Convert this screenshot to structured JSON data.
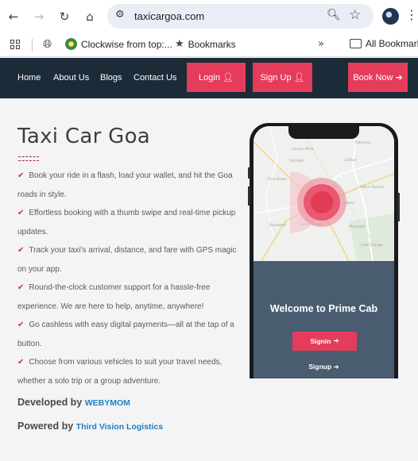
{
  "browser": {
    "url": "taxicargoa.com",
    "bookmarks": [
      {
        "label": "Clockwise from top:...",
        "icon": "wikipedia-icon"
      },
      {
        "label": "Bookmarks",
        "icon": "star-icon"
      },
      {
        "label": "All Bookmarks",
        "icon": "folder-icon"
      }
    ]
  },
  "header": {
    "nav": [
      "Home",
      "About Us",
      "Blogs",
      "Contact Us"
    ],
    "login_label": "Login",
    "signup_label": "Sign Up",
    "book_label": "Book Now",
    "colors": {
      "bar": "#1c2b38",
      "accent": "#e63c5c"
    }
  },
  "main": {
    "title": "Taxi Car Goa",
    "features": [
      "Book your ride in a flash, load your wallet, and hit the Goa roads in style.",
      "Effortless booking with a thumb swipe and real-time pickup updates.",
      "Track your taxi's arrival, distance, and fare with GPS magic on your app.",
      "Round-the-clock customer support for a hassle-free experience. We are here to help, anytime, anywhere!",
      "Go cashless with easy digital payments—all at the tap of a button.",
      "Choose from various vehicles to suit your travel needs, whether a solo trip or a group adventure."
    ],
    "developed_by_label": "Developed by",
    "developed_by_brand": "WEBYMOM",
    "powered_by_label": "Powered by",
    "powered_by_brand": "Third Vision Logistics"
  },
  "phone": {
    "welcome": "Welcome to Prime Cab",
    "signin_label": "Signin",
    "signup_label": "Signup"
  }
}
